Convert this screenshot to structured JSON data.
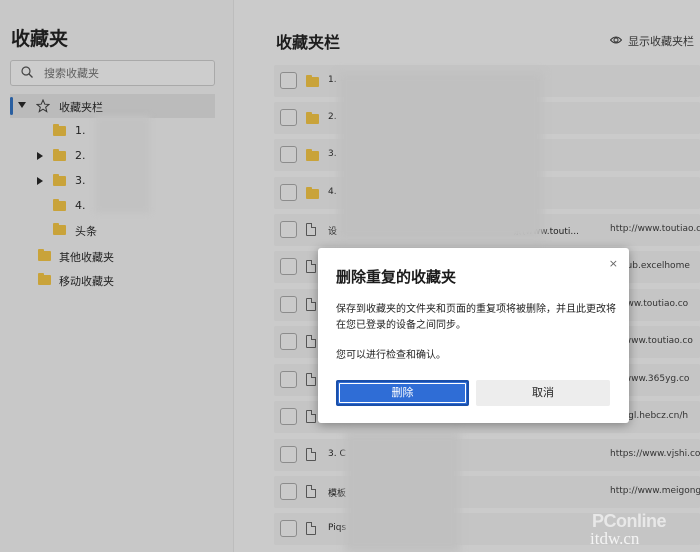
{
  "sidebar": {
    "title": "收藏夹",
    "search_placeholder": "搜索收藏夹",
    "tree": {
      "root": "收藏夹栏",
      "children": [
        "1.",
        "2.",
        "3.",
        "4.",
        "头条"
      ],
      "other": "其他收藏夹",
      "mobile": "移动收藏夹"
    }
  },
  "main": {
    "title": "收藏夹栏",
    "show_bar_label": "显示收藏夹栏",
    "rows": [
      {
        "type": "folder",
        "name": "1.",
        "url": ""
      },
      {
        "type": "folder",
        "name": "2.",
        "url": ""
      },
      {
        "type": "folder",
        "name": "3.",
        "url": ""
      },
      {
        "type": "folder",
        "name": "4.",
        "url": ""
      },
      {
        "type": "page",
        "name": "设",
        "name_tail": "条(www.touti...",
        "url": "http://www.toutiao.co"
      },
      {
        "type": "page",
        "name": "",
        "name_tail": "",
        "url": "://club.excelhome"
      },
      {
        "type": "page",
        "name": "",
        "name_tail": "",
        "url": "://www.toutiao.co"
      },
      {
        "type": "page",
        "name": "",
        "name_tail": "",
        "url": "s://www.toutiao.co"
      },
      {
        "type": "page",
        "name": "",
        "name_tail": "",
        "url": "s://www.365yg.co"
      },
      {
        "type": "page",
        "name": "",
        "name_tail": "",
        "url": "://rygl.hebcz.cn/h"
      },
      {
        "type": "page",
        "name": "3. C",
        "name_tail": "",
        "url": "https://www.vjshi.com"
      },
      {
        "type": "page",
        "name": "模板",
        "name_tail": "",
        "url": "http://www.meigongy"
      },
      {
        "type": "page",
        "name": "Piqs",
        "name_tail": "",
        "url": ""
      }
    ]
  },
  "dialog": {
    "title": "删除重复的收藏夹",
    "body": "保存到收藏夹的文件夹和页面的重复项将被删除，并且此更改将在您已登录的设备之间同步。",
    "body2": "您可以进行检查和确认。",
    "delete_label": "删除",
    "cancel_label": "取消",
    "close_glyph": "×"
  },
  "watermark": {
    "line1": "PConline",
    "line2": "itdw.cn"
  },
  "colors": {
    "primary_button": "#2f6dd6",
    "selection_bar": "#2a5fa0",
    "folder": "#c9a33a"
  }
}
